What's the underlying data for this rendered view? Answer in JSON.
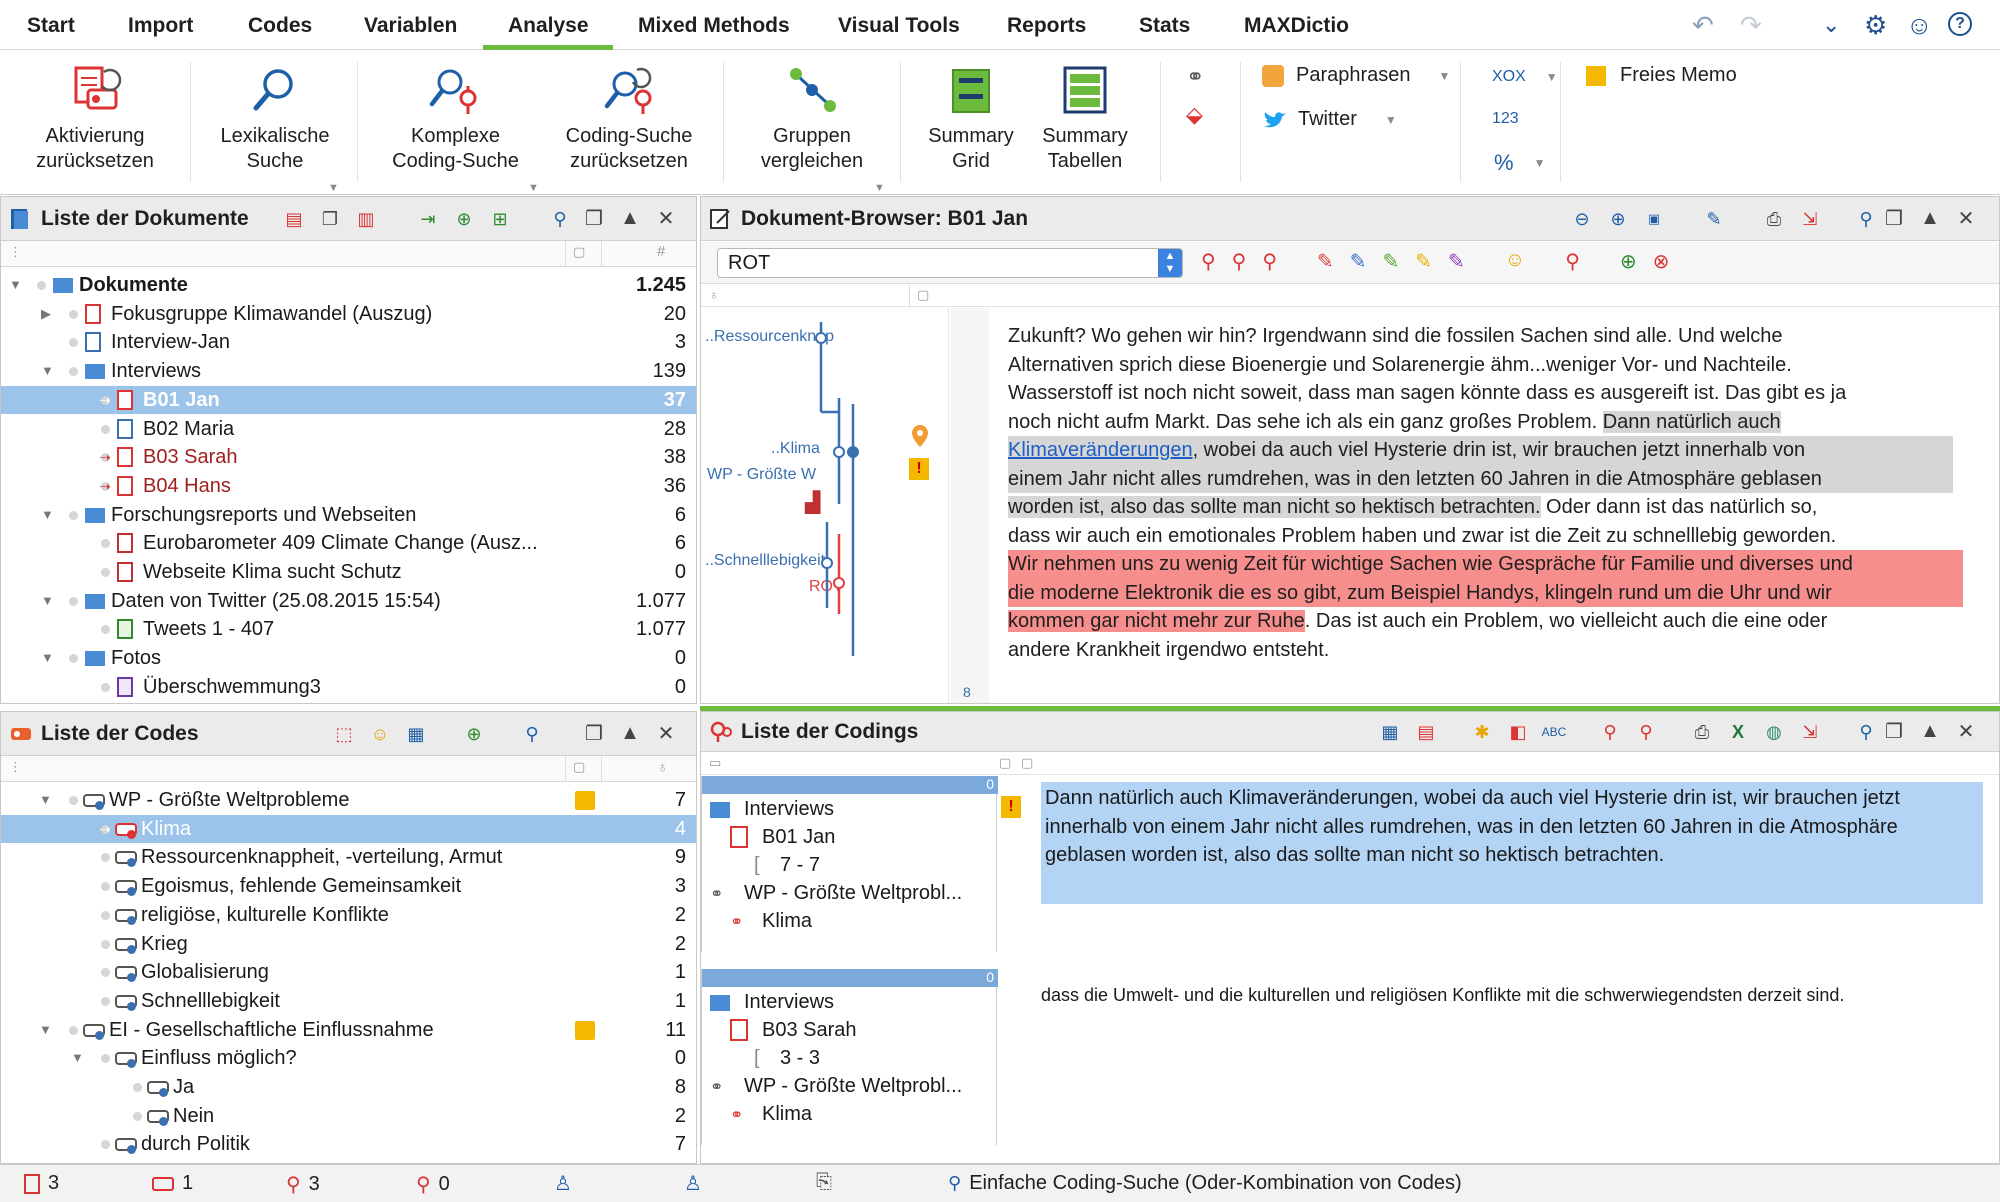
{
  "menu": {
    "items": [
      "Start",
      "Import",
      "Codes",
      "Variablen",
      "Analyse",
      "Mixed Methods",
      "Visual Tools",
      "Reports",
      "Stats",
      "MAXDictio"
    ],
    "active": "Analyse"
  },
  "ribbon": {
    "buttons": [
      {
        "line1": "Aktivierung",
        "line2": "zurücksetzen"
      },
      {
        "line1": "Lexikalische",
        "line2": "Suche"
      },
      {
        "line1": "Komplexe",
        "line2": "Coding-Suche"
      },
      {
        "line1": "Coding-Suche",
        "line2": "zurücksetzen"
      },
      {
        "line1": "Gruppen",
        "line2": "vergleichen"
      },
      {
        "line1": "Summary",
        "line2": "Grid"
      },
      {
        "line1": "Summary",
        "line2": "Tabellen"
      }
    ],
    "paraphrasen": "Paraphrasen",
    "twitter": "Twitter",
    "xox": "XOX",
    "n123": "123",
    "percent": "%",
    "freies_memo": "Freies Memo"
  },
  "docs_panel": {
    "title": "Liste der Dokumente",
    "rows": [
      {
        "label": "Dokumente",
        "num": "1.245"
      },
      {
        "label": "Fokusgruppe Klimawandel (Auszug)",
        "num": "20"
      },
      {
        "label": "Interview-Jan",
        "num": "3"
      },
      {
        "label": "Interviews",
        "num": "139"
      },
      {
        "label": "B01 Jan",
        "num": "37"
      },
      {
        "label": "B02 Maria",
        "num": "28"
      },
      {
        "label": "B03 Sarah",
        "num": "38"
      },
      {
        "label": "B04 Hans",
        "num": "36"
      },
      {
        "label": "Forschungsreports und Webseiten",
        "num": "6"
      },
      {
        "label": "Eurobarometer 409 Climate Change (Ausz...",
        "num": "6"
      },
      {
        "label": "Webseite Klima sucht Schutz",
        "num": "0"
      },
      {
        "label": "Daten von Twitter (25.08.2015 15:54)",
        "num": "1.077"
      },
      {
        "label": "Tweets 1 - 407",
        "num": "1.077"
      },
      {
        "label": "Fotos",
        "num": "0"
      },
      {
        "label": "Überschwemmung3",
        "num": "0"
      }
    ]
  },
  "browser_panel": {
    "title": "Dokument-Browser: B01 Jan",
    "code_select": "ROT",
    "margin_codes": [
      "..Ressourcenknap",
      "..Klima",
      "WP - Größte W",
      "..Schnelllebigkeit",
      "ROT"
    ],
    "para_number": "8",
    "lines": [
      "Zukunft? Wo gehen wir hin? Irgendwann sind die fossilen Sachen sind alle. Und welche",
      "Alternativen sprich diese Bioenergie und Solarenergie ähm...weniger Vor- und Nachteile.",
      "Wasserstoff ist noch nicht soweit, dass man sagen könnte dass es ausgereift ist. Das gibt es ja",
      "noch nicht aufm Markt. Das sehe ich als ein ganz großes Problem.",
      "Dann natürlich auch",
      "Klimaveränderungen",
      ", wobei da auch viel Hysterie drin ist, wir brauchen jetzt innerhalb von",
      "einem Jahr nicht alles rumdrehen, was in den letzten 60 Jahren in die Atmosphäre geblasen",
      "worden ist, also das sollte man nicht so hektisch betrachten.",
      " Oder dann ist das natürlich so,",
      "dass wir auch ein emotionales Problem haben und zwar ist die Zeit zu schnelllebig geworden.",
      "Wir nehmen uns zu wenig Zeit für wichtige Sachen wie Gespräche für Familie und diverses und",
      "die moderne Elektronik die es so gibt, zum Beispiel Handys, klingeln rund um die Uhr und wir",
      "kommen gar nicht mehr zur Ruhe",
      ". Das ist auch ein Problem, wo vielleicht auch die eine oder",
      "andere Krankheit irgendwo entsteht."
    ]
  },
  "codes_panel": {
    "title": "Liste der Codes",
    "rows": [
      {
        "label": "WP - Größte Weltprobleme",
        "num": "7"
      },
      {
        "label": "Klima",
        "num": "4"
      },
      {
        "label": "Ressourcenknappheit, -verteilung, Armut",
        "num": "9"
      },
      {
        "label": "Egoismus, fehlende Gemeinsamkeit",
        "num": "3"
      },
      {
        "label": "religiöse, kulturelle Konflikte",
        "num": "2"
      },
      {
        "label": "Krieg",
        "num": "2"
      },
      {
        "label": "Globalisierung",
        "num": "1"
      },
      {
        "label": "Schnelllebigkeit",
        "num": "1"
      },
      {
        "label": "EI - Gesellschaftliche Einflussnahme",
        "num": "11"
      },
      {
        "label": "Einfluss möglich?",
        "num": "0"
      },
      {
        "label": "Ja",
        "num": "8"
      },
      {
        "label": "Nein",
        "num": "2"
      },
      {
        "label": "durch Politik",
        "num": "7"
      }
    ]
  },
  "codings_panel": {
    "title": "Liste der Codings",
    "items": [
      {
        "badge": "0",
        "folder": "Interviews",
        "doc": "B01 Jan",
        "range": "7 - 7",
        "parent": "WP - Größte Weltprobl...",
        "code": "Klima",
        "text": "Dann natürlich auch Klimaveränderungen, wobei da auch viel Hysterie drin ist, wir brauchen jetzt innerhalb von einem Jahr nicht alles rumdrehen, was in den letzten 60 Jahren in die Atmosphäre geblasen worden ist, also das sollte man nicht so hektisch betrachten."
      },
      {
        "badge": "0",
        "folder": "Interviews",
        "doc": "B03 Sarah",
        "range": "3 - 3",
        "parent": "WP - Größte Weltprobl...",
        "code": "Klima",
        "text": "dass die Umwelt- und die kulturellen und religiösen Konflikte mit die schwerwiegendsten derzeit sind."
      }
    ]
  },
  "statusbar": {
    "docs": "3",
    "codes": "1",
    "codings_a": "3",
    "codings_b": "0",
    "message": "Einfache Coding-Suche (Oder-Kombination von Codes)"
  },
  "colors": {
    "accent": "#6cbb3c",
    "selection": "#9cc3ea",
    "highlight_red": "#f78e8e",
    "highlight_gray": "#d6d6d6",
    "highlight_blue": "#b3d4f5"
  }
}
